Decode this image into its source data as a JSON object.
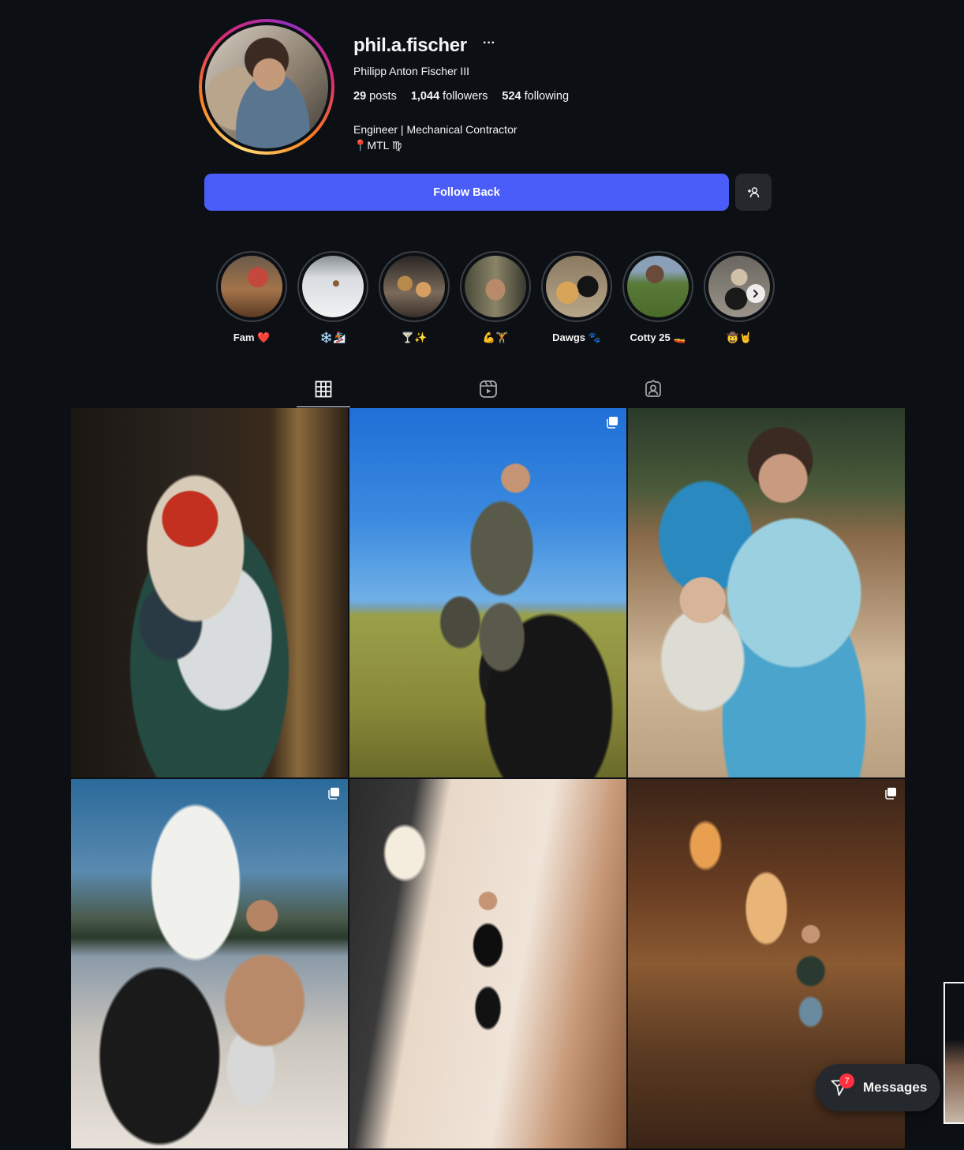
{
  "profile": {
    "username": "phil.a.fischer",
    "more_icon": "···",
    "full_name": "Philipp Anton Fischer III",
    "stats": [
      {
        "value": "29",
        "label": "posts"
      },
      {
        "value": "1,044",
        "label": "followers"
      },
      {
        "value": "524",
        "label": "following"
      }
    ],
    "bio_line1": "Engineer | Mechanical Contractor",
    "bio_line2": "📍MTL ♍"
  },
  "actions": {
    "follow_back_label": "Follow Back",
    "add_user_icon": "person-add-icon"
  },
  "highlights": [
    {
      "label": "Fam ❤️"
    },
    {
      "label": "❄️🏂"
    },
    {
      "label": "🍸✨"
    },
    {
      "label": "💪🏋️"
    },
    {
      "label": "Dawgs 🐾"
    },
    {
      "label": "Cotty 25 🚤"
    },
    {
      "label": "🤠🤘"
    }
  ],
  "tabs": [
    {
      "name": "posts",
      "icon": "grid-icon",
      "active": true
    },
    {
      "name": "reels",
      "icon": "reels-icon",
      "active": false
    },
    {
      "name": "tagged",
      "icon": "tagged-icon",
      "active": false
    }
  ],
  "posts": [
    {
      "multi": false
    },
    {
      "multi": true
    },
    {
      "multi": false
    },
    {
      "multi": true
    },
    {
      "multi": false
    },
    {
      "multi": true
    }
  ],
  "messages": {
    "label": "Messages",
    "badge_count": "7"
  },
  "colors": {
    "background": "#0c1014",
    "primary_button": "#4a5df9",
    "secondary_button": "#25292e",
    "badge": "#ff3040"
  }
}
